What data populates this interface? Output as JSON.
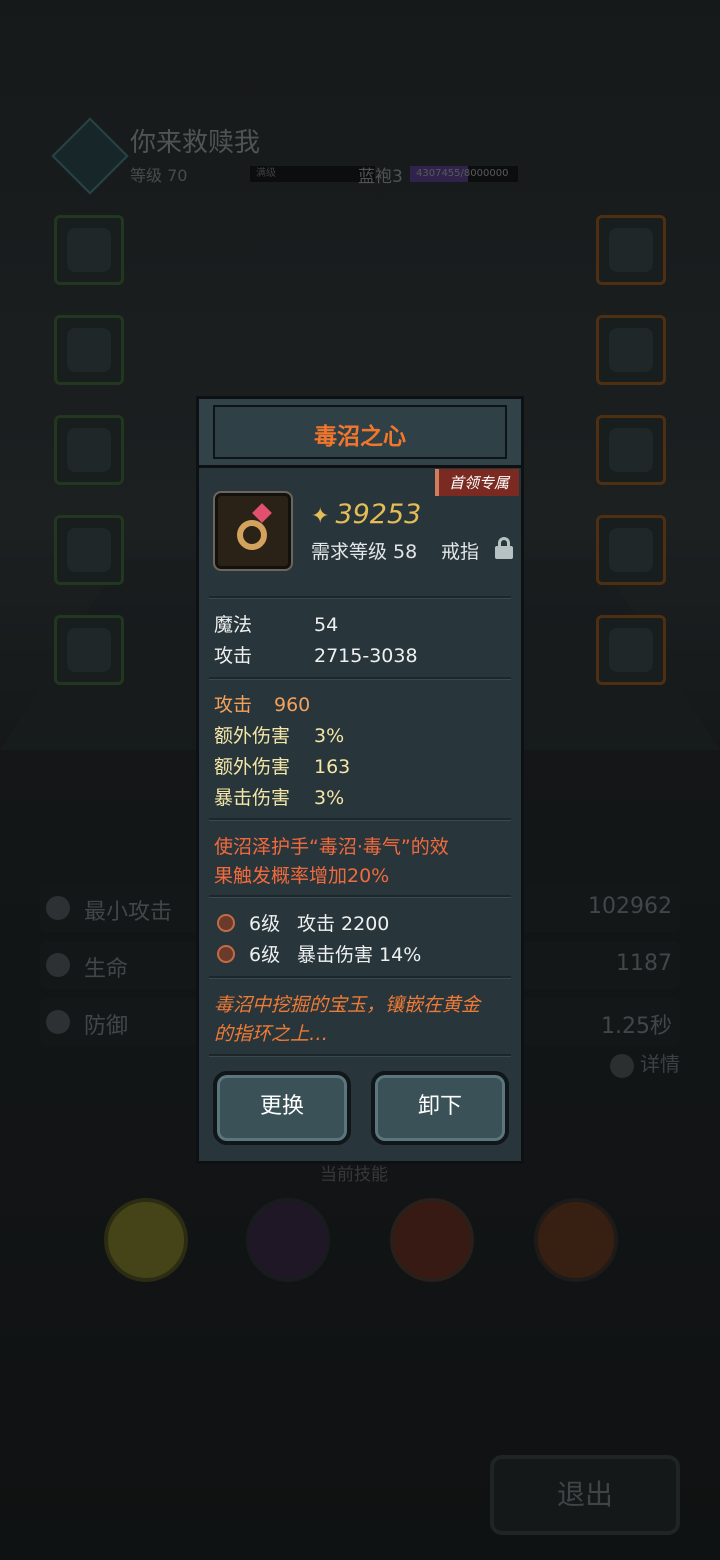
{
  "player": {
    "name": "你来救赎我",
    "level": "等级 70",
    "max_label": "满级",
    "rank": "蓝袍3",
    "exp": "4307455/8000000",
    "exp_progress": 0.538
  },
  "stats": [
    {
      "label": "最小攻击",
      "value": "102962",
      "icon": "sword-icon"
    },
    {
      "label": "生命",
      "value": "1187",
      "icon": "heart-icon"
    },
    {
      "label": "防御",
      "value": "1.25秒",
      "icon": "shield-icon"
    }
  ],
  "detail_label": "详情",
  "skills_label": "当前技能",
  "exit_label": "退出",
  "item": {
    "title": "毒沼之心",
    "tag": "首领专属",
    "price": "39253",
    "req_level": "需求等级 58",
    "type": "戒指",
    "base_stats": [
      {
        "k": "魔法",
        "v": "54"
      },
      {
        "k": "攻击",
        "v": "2715-3038"
      }
    ],
    "bonus_stats": [
      {
        "k": "攻击",
        "v": "960"
      },
      {
        "k": "额外伤害",
        "v": "3%"
      },
      {
        "k": "额外伤害",
        "v": "163"
      },
      {
        "k": "暴击伤害",
        "v": "3%"
      }
    ],
    "effect_line1": "使沼泽护手“毒沼·毒气”的效",
    "effect_line2": "果触发概率增加20%",
    "enchants": [
      {
        "level": "6级",
        "text": "攻击 2200"
      },
      {
        "level": "6级",
        "text": "暴击伤害 14%"
      }
    ],
    "lore_line1": "毒沼中挖掘的宝玉，镶嵌在黄金",
    "lore_line2": "的指环之上…",
    "replace_label": "更换",
    "unequip_label": "卸下"
  },
  "colors": {
    "title": "#f2762b",
    "price": "#e4bd57",
    "bonus_orange": "#f5a15a",
    "bonus_yellow": "#f3e6a7",
    "effect_red": "#f26a3c"
  }
}
